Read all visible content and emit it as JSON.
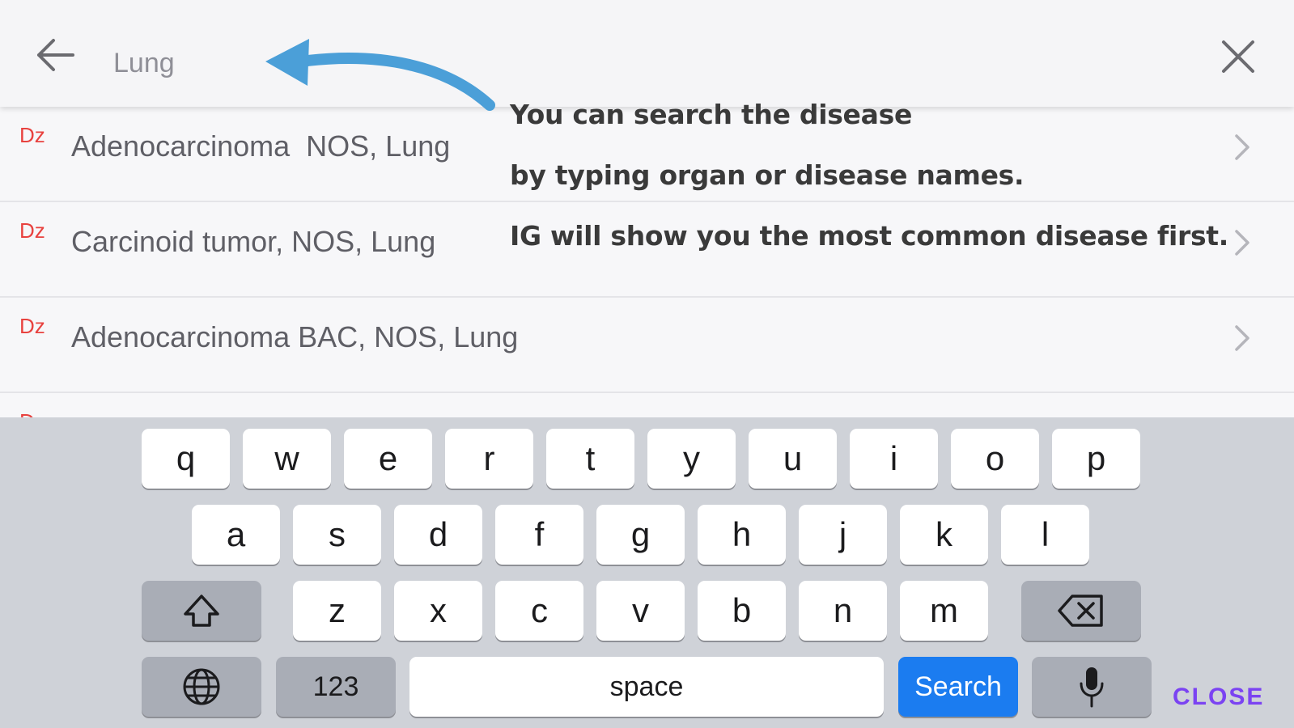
{
  "search": {
    "value": "Lung"
  },
  "results": [
    {
      "badge": "Dz",
      "label": "Adenocarcinoma  NOS, Lung"
    },
    {
      "badge": "Dz",
      "label": "Carcinoid tumor, NOS, Lung"
    },
    {
      "badge": "Dz",
      "label": "Adenocarcinoma BAC, NOS, Lung"
    },
    {
      "badge": "Dz",
      "label": ""
    }
  ],
  "annotation": {
    "lines": [
      "You can search the disease",
      "by typing organ or disease names.",
      "IG will show you the most common disease first."
    ]
  },
  "keyboard": {
    "row1": [
      "q",
      "w",
      "e",
      "r",
      "t",
      "y",
      "u",
      "i",
      "o",
      "p"
    ],
    "row2": [
      "a",
      "s",
      "d",
      "f",
      "g",
      "h",
      "j",
      "k",
      "l"
    ],
    "row3": [
      "z",
      "x",
      "c",
      "v",
      "b",
      "n",
      "m"
    ],
    "numbers_key": "123",
    "space_key": "space",
    "search_key": "Search"
  },
  "close_label": "CLOSE",
  "colors": {
    "badge": "#e8423f",
    "arrow": "#4b9fd8",
    "search_key": "#1b7cf0",
    "close": "#7b43f2"
  }
}
